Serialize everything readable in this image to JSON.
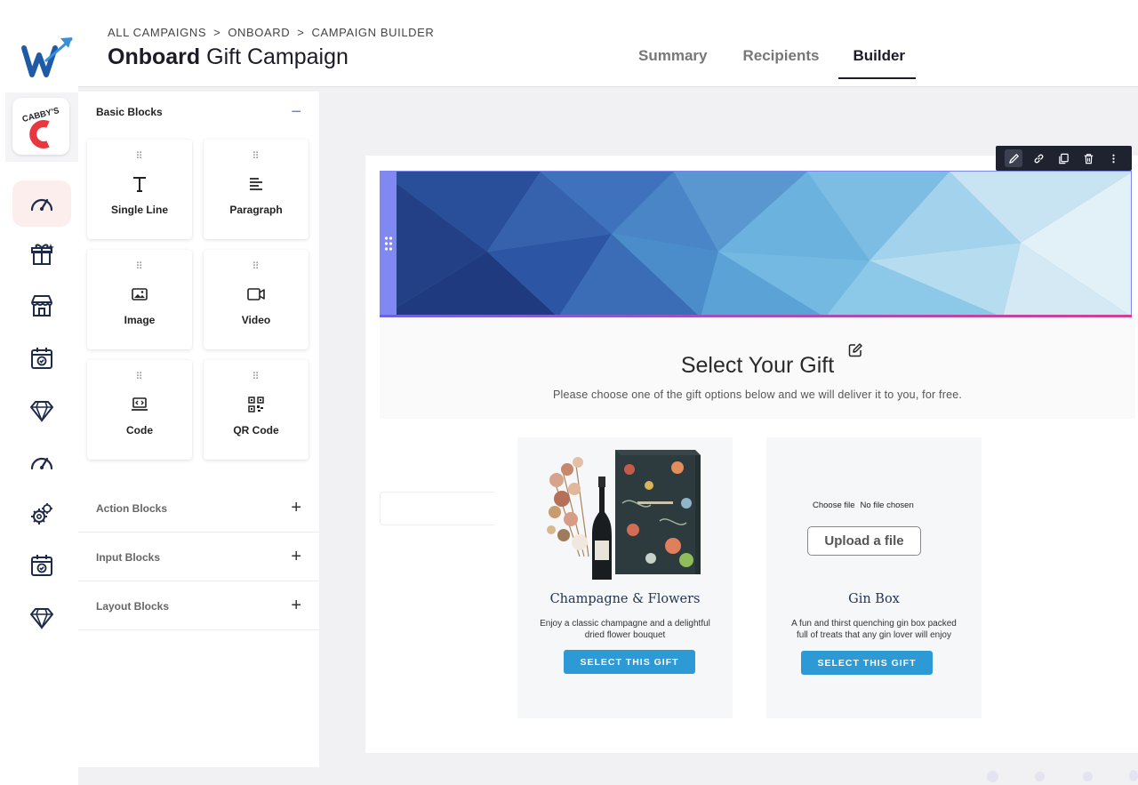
{
  "breadcrumb": {
    "items": [
      "ALL CAMPAIGNS",
      "ONBOARD",
      "CAMPAIGN BUILDER"
    ],
    "separator": ">"
  },
  "page_title": {
    "bold": "Onboard",
    "rest": "Gift Campaign"
  },
  "tabs": [
    {
      "label": "Summary",
      "active": false
    },
    {
      "label": "Recipients",
      "active": false
    },
    {
      "label": "Builder",
      "active": true
    }
  ],
  "brand": {
    "name": "CABBY'S",
    "initial": "C",
    "color": "#e8373f"
  },
  "rail": {
    "items": [
      {
        "icon": "speedometer-icon",
        "active": true
      },
      {
        "icon": "gift-icon",
        "active": false
      },
      {
        "icon": "store-icon",
        "active": false
      },
      {
        "icon": "calendar-check-icon",
        "active": false
      },
      {
        "icon": "diamond-icon",
        "active": false
      },
      {
        "icon": "speedometer-icon",
        "active": false
      },
      {
        "icon": "gears-icon",
        "active": false
      },
      {
        "icon": "calendar-check-icon",
        "active": false
      },
      {
        "icon": "diamond-icon",
        "active": false
      }
    ]
  },
  "blocks_panel": {
    "basic": {
      "label": "Basic Blocks",
      "toggle": "−",
      "tiles": [
        {
          "label": "Single Line",
          "icon": "text-t-icon"
        },
        {
          "label": "Paragraph",
          "icon": "paragraph-icon"
        },
        {
          "label": "Image",
          "icon": "image-icon"
        },
        {
          "label": "Video",
          "icon": "video-icon"
        },
        {
          "label": "Code",
          "icon": "code-icon"
        },
        {
          "label": "QR Code",
          "icon": "qr-code-icon"
        }
      ]
    },
    "action": {
      "label": "Action Blocks",
      "toggle": "+"
    },
    "input": {
      "label": "Input Blocks",
      "toggle": "+"
    },
    "layout": {
      "label": "Layout Blocks",
      "toggle": "+"
    }
  },
  "canvas": {
    "heading": "Select Your Gift",
    "subheading": "Please choose one of the gift options below and we will deliver it to you, for free.",
    "toolbar": [
      "edit-icon",
      "link-icon",
      "duplicate-icon",
      "trash-icon",
      "more-icon"
    ],
    "gifts": [
      {
        "name": "Champagne & Flowers",
        "description": "Enjoy a classic champagne and a delightful dried flower bouquet",
        "button": "SELECT THIS GIFT"
      },
      {
        "name": "Gin Box",
        "description": "A fun and thirst quenching gin box packed full of treats that any gin lover will enjoy",
        "button": "SELECT THIS GIFT",
        "file_button": "Choose file",
        "file_status": "No file chosen",
        "upload_label": "Upload a file"
      }
    ]
  },
  "colors": {
    "accent": "#6b79f2",
    "select_button": "#2d9ad6",
    "brand_red": "#e8373f",
    "logo_blue": "#1f5aa6"
  }
}
